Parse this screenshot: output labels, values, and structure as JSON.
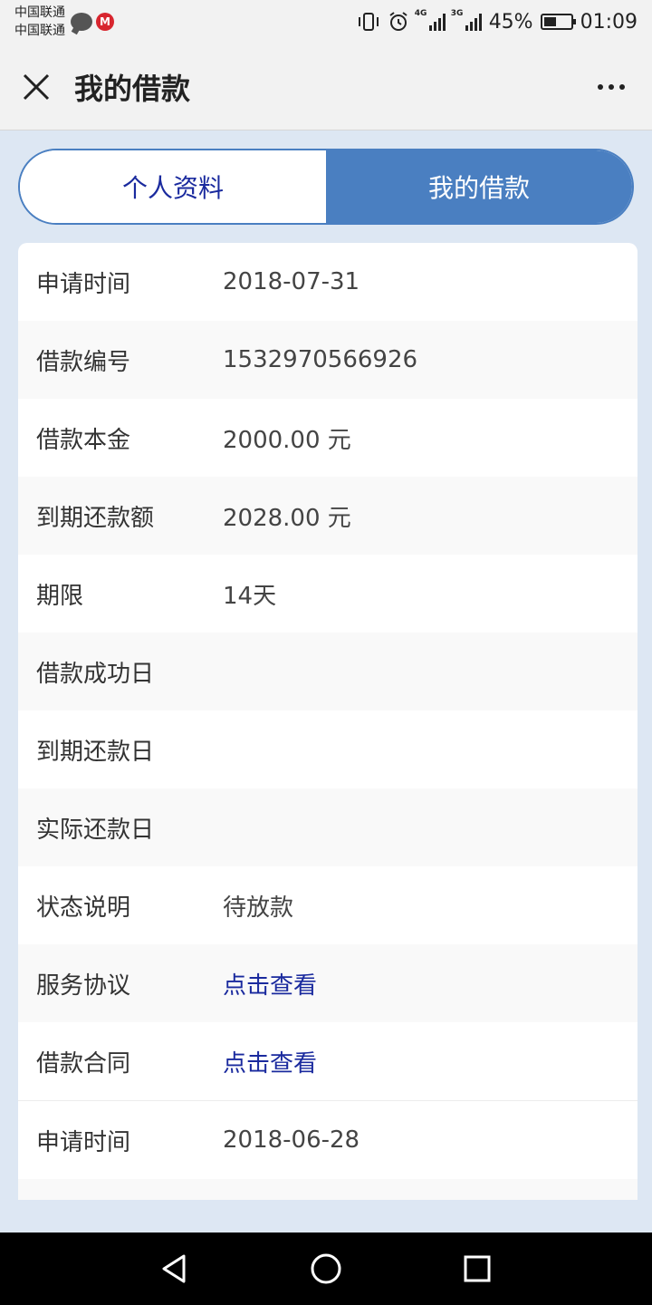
{
  "status_bar": {
    "carrier_1": "中国联通",
    "carrier_2": "中国联通",
    "battery": "45%",
    "time": "01:09",
    "net_1": "4G",
    "net_2": "3G"
  },
  "header": {
    "title": "我的借款"
  },
  "tabs": [
    {
      "label": "个人资料",
      "active": false
    },
    {
      "label": "我的借款",
      "active": true
    }
  ],
  "loan_1": {
    "rows": [
      {
        "label": "申请时间",
        "value": "2018-07-31"
      },
      {
        "label": "借款编号",
        "value": "1532970566926"
      },
      {
        "label": "借款本金",
        "value": "2000.00 元"
      },
      {
        "label": "到期还款额",
        "value": "2028.00 元"
      },
      {
        "label": "期限",
        "value": "14天"
      },
      {
        "label": "借款成功日",
        "value": ""
      },
      {
        "label": "到期还款日",
        "value": ""
      },
      {
        "label": "实际还款日",
        "value": ""
      },
      {
        "label": "状态说明",
        "value": "待放款"
      },
      {
        "label": "服务协议",
        "value": "点击查看"
      },
      {
        "label": "借款合同",
        "value": "点击查看"
      }
    ]
  },
  "loan_2": {
    "rows": [
      {
        "label": "申请时间",
        "value": "2018-06-28"
      }
    ]
  },
  "colors": {
    "accent": "#4a7fc1",
    "link": "#1a2a9e",
    "page_bg": "#dde7f3"
  }
}
